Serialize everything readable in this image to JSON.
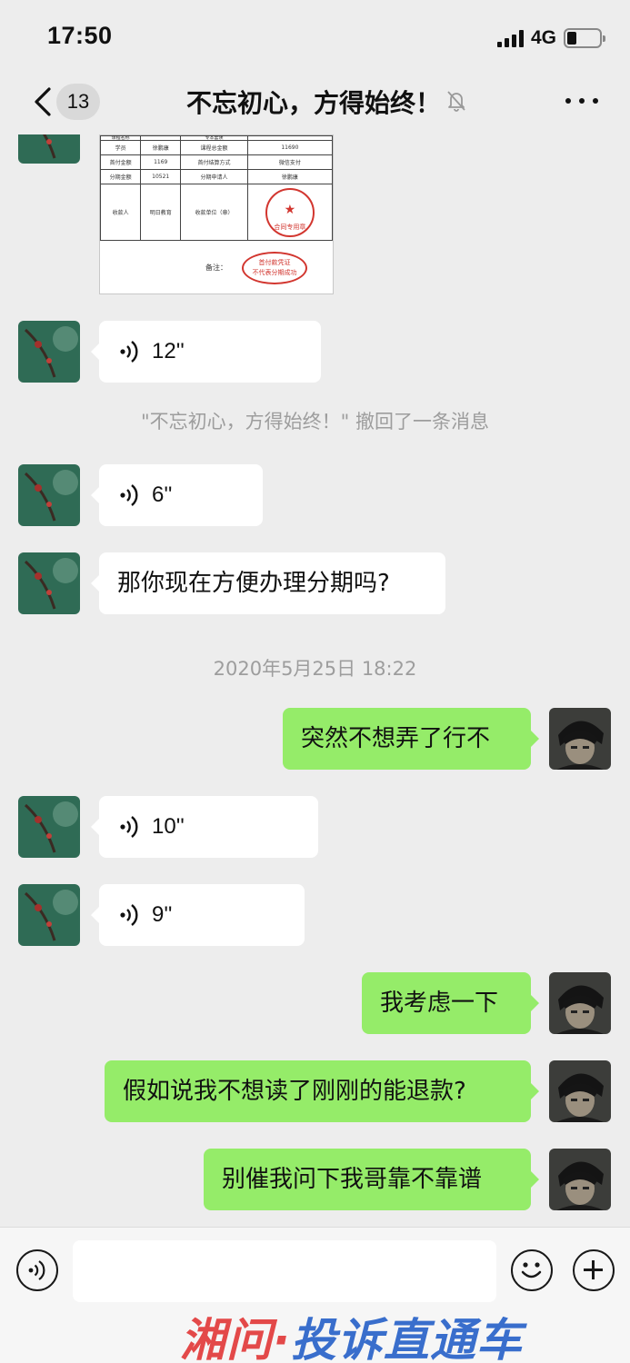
{
  "status_bar": {
    "time": "17:50",
    "network": "4G"
  },
  "nav": {
    "unread_count": "13",
    "title": "不忘初心，方得始终！"
  },
  "receipt": {
    "header_left": "课程名称",
    "header_right": "专本套读",
    "rows": [
      [
        "学员",
        "徐鹏康",
        "课程总金额",
        "11690"
      ],
      [
        "首付金额",
        "1169",
        "首付结算方式",
        "微信支付"
      ],
      [
        "分期金额",
        "10521",
        "分期申请人",
        "徐鹏康"
      ]
    ],
    "payee_label": "收款人",
    "payee_value": "明日教育",
    "unit_label": "收款单位（章）",
    "stamp_text": "合同专用章",
    "note_label": "备注：",
    "note_stamp_line1": "首付款凭证",
    "note_stamp_line2": "不代表分期成功"
  },
  "messages": {
    "m1_voice": "12''",
    "recall_notice": "\"不忘初心，方得始终！\" 撤回了一条消息",
    "m2_voice": "6''",
    "m3_text": "那你现在方便办理分期吗?",
    "timestamp": "2020年5月25日 18:22",
    "m4_text": "突然不想弄了行不",
    "m5_voice": "10''",
    "m6_voice": "9''",
    "m7_text": "我考虑一下",
    "m8_text": "假如说我不想读了刚刚的能退款?",
    "m9_text": "别催我问下我哥靠不靠谱"
  },
  "input": {
    "placeholder": ""
  },
  "watermark": {
    "part1": "湘问·",
    "part2": "投诉直通车"
  },
  "colors": {
    "sent_bubble": "#95ec69",
    "received_bubble": "#ffffff",
    "background": "#ededed"
  }
}
